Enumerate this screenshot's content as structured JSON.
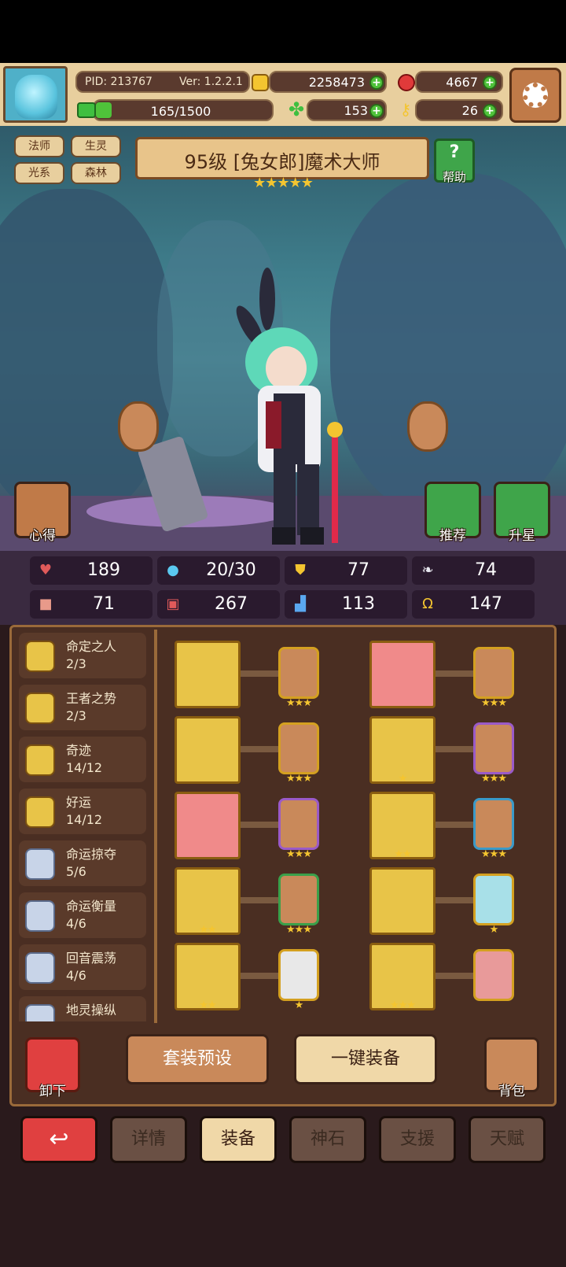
{
  "header": {
    "pid": "PID: 213767",
    "version": "Ver: 1.2.2.1",
    "gold": "2258473",
    "gems": "4667",
    "energy": "165/1500",
    "clover": "153",
    "keys": "26"
  },
  "tags": [
    "法师",
    "生灵",
    "光系",
    "森林"
  ],
  "hero": {
    "title": "95级 [兔女郎]魔术大师",
    "stars": "★★★★★",
    "help_label": "帮助"
  },
  "side_buttons": {
    "xinde": "心得",
    "tuijian": "推荐",
    "shengxing": "升星"
  },
  "stats": [
    {
      "icon": "heart-icon",
      "value": "189"
    },
    {
      "icon": "mana-drop-icon",
      "value": "20/30"
    },
    {
      "icon": "shield-icon",
      "value": "77"
    },
    {
      "icon": "wing-icon",
      "value": "74"
    },
    {
      "icon": "fist-icon",
      "value": "71"
    },
    {
      "icon": "book-icon",
      "value": "267"
    },
    {
      "icon": "boot-icon",
      "value": "113"
    },
    {
      "icon": "horseshoe-icon",
      "value": "147"
    }
  ],
  "sets": [
    {
      "name": "命定之人",
      "count": "2/3",
      "tier": "gold"
    },
    {
      "name": "王者之势",
      "count": "2/3",
      "tier": "gold"
    },
    {
      "name": "奇迹",
      "count": "14/12",
      "tier": "gold"
    },
    {
      "name": "好运",
      "count": "14/12",
      "tier": "gold"
    },
    {
      "name": "命运掠夺",
      "count": "5/6",
      "tier": "silver"
    },
    {
      "name": "命运衡量",
      "count": "4/6",
      "tier": "silver"
    },
    {
      "name": "回音震荡",
      "count": "4/6",
      "tier": "silver"
    },
    {
      "name": "地灵操纵",
      "count": "",
      "tier": "silver"
    }
  ],
  "equipment": [
    {
      "item": "axe-icon",
      "item_stars": "",
      "rune_stars": "★★★"
    },
    {
      "item": "straw-hat-icon",
      "item_stars": "",
      "rune_stars": "★★★"
    },
    {
      "item": "orb-icon",
      "item_stars": "",
      "rune_stars": "★★★"
    },
    {
      "item": "armor-icon",
      "item_stars": "★",
      "rune_stars": "★★★"
    },
    {
      "item": "amulet-icon",
      "item_stars": "",
      "rune_stars": "★★★"
    },
    {
      "item": "scroll-icon",
      "item_stars": "★★",
      "rune_stars": "★★★"
    },
    {
      "item": "jewel-icon",
      "item_stars": "★★",
      "rune_stars": "★★★"
    },
    {
      "item": "bracelet-icon",
      "item_stars": "",
      "rune_stars": "★"
    },
    {
      "item": "ring-icon",
      "item_stars": "★★",
      "rune_stars": "★"
    },
    {
      "item": "boots-icon",
      "item_stars": "★★★",
      "rune_stars": ""
    }
  ],
  "actions": {
    "unequip": "卸下",
    "preset": "套装预设",
    "equip_all": "一键装备",
    "bag": "背包"
  },
  "tabs": [
    {
      "label": "详情",
      "active": false
    },
    {
      "label": "装备",
      "active": true
    },
    {
      "label": "神石",
      "active": false
    },
    {
      "label": "支援",
      "active": false
    },
    {
      "label": "天赋",
      "active": false
    }
  ],
  "back_glyph": "↩"
}
